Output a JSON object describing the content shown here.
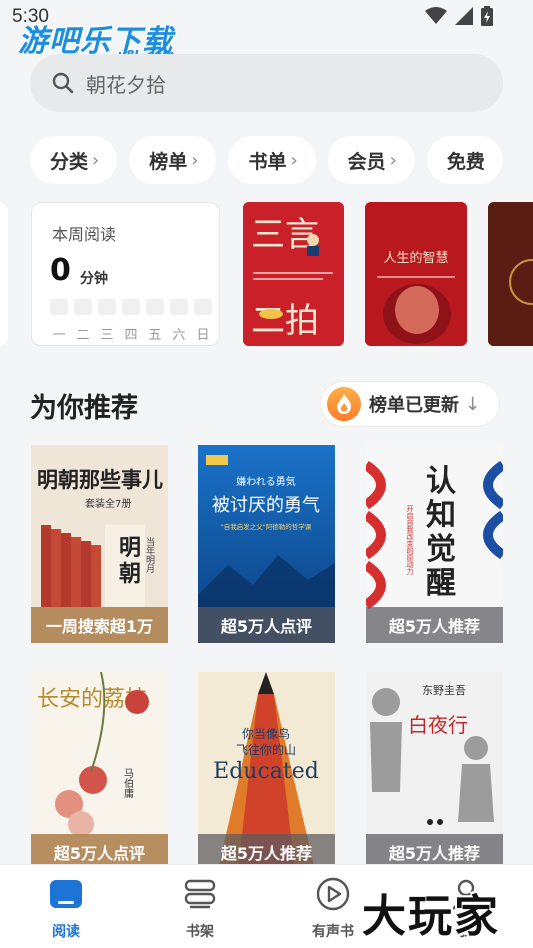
{
  "status": {
    "time": "5:30"
  },
  "watermark_top": {
    "cn": "游吧乐下载",
    "en": "y8L.com"
  },
  "search": {
    "placeholder": "朝花夕拾"
  },
  "chips": [
    {
      "label": "分类"
    },
    {
      "label": "榜单"
    },
    {
      "label": "书单"
    },
    {
      "label": "会员"
    },
    {
      "label": "免费"
    }
  ],
  "weekly": {
    "label": "本周阅读",
    "minutes": "0",
    "unit": "分钟",
    "days": [
      "一",
      "二",
      "三",
      "四",
      "五",
      "六",
      "日"
    ]
  },
  "shelf_books": [
    {
      "title_lines": [
        "三言",
        "二拍"
      ],
      "color": "#c9202a"
    },
    {
      "title": "人生的智慧",
      "color": "#b8181e"
    },
    {
      "title": "",
      "color": "#5a1d14"
    }
  ],
  "recommend": {
    "title": "为你推荐",
    "updated_label": "榜单已更新"
  },
  "books": [
    {
      "title": "明朝那些事儿",
      "sub": "套装全7册",
      "author": "当年明月",
      "tag": "一周搜索超1万",
      "tag_style": "warm"
    },
    {
      "title": "被讨厌的勇气",
      "sub": "\"自我启发之父\"阿德勒的哲学课",
      "top": "嫌われる勇気",
      "tag": "超5万人点评"
    },
    {
      "title": "认知觉醒",
      "sub": "开启自我改变的原动力",
      "tag": "超5万人推荐"
    },
    {
      "title": "长安的荔枝",
      "author": "马伯庸",
      "tag": "超5万人点评",
      "tag_style": "warm"
    },
    {
      "title_lines": [
        "你当像鸟",
        "飞往你的山"
      ],
      "en": "Educated",
      "tag": "超5万人推荐"
    },
    {
      "author": "东野圭吾",
      "title": "白夜行",
      "tag": "超5万人推荐"
    }
  ],
  "tabs": [
    {
      "label": "阅读",
      "active": true
    },
    {
      "label": "书架"
    },
    {
      "label": "有声书"
    },
    {
      "label": "我"
    }
  ],
  "watermark_bottom": "大玩家",
  "colors": {
    "accent": "#1d74d6",
    "bg": "#f4f5f7"
  }
}
